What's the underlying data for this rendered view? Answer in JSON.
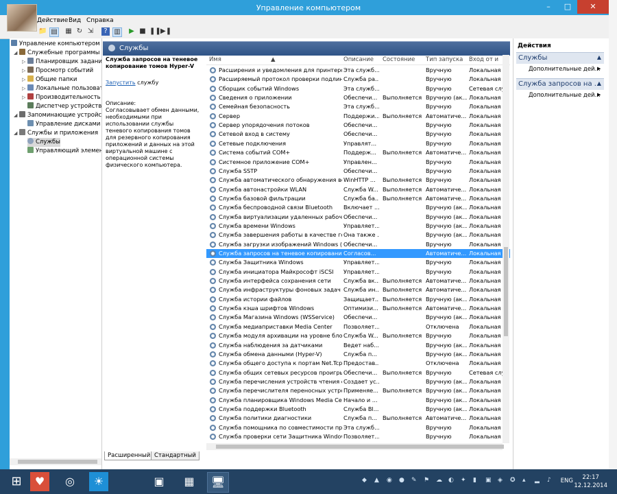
{
  "window": {
    "title": "Управление компьютером",
    "minimize": "–",
    "maximize": "□",
    "close": "✕"
  },
  "menu": [
    "Действие",
    "Вид",
    "Справка"
  ],
  "toolbar": {
    "icons": [
      "back-icon",
      "forward-icon",
      "folder-up-icon",
      "show-tree-icon",
      "properties-icon",
      "refresh-icon",
      "export-icon",
      "help-icon",
      "console-icon",
      "play-icon",
      "stop-icon",
      "pause-icon",
      "restart-icon"
    ]
  },
  "tree": {
    "items": [
      {
        "label": "Управление компьютером (л",
        "arrow": "",
        "icon_color": "#5b7fa8"
      },
      {
        "label": "Служебные программы",
        "arrow": "◢",
        "icon_color": "#8a6a3a"
      },
      {
        "label": "Планировщик заданий",
        "arrow": "▷",
        "icon_color": "#6c7f9a"
      },
      {
        "label": "Просмотр событий",
        "arrow": "▷",
        "icon_color": "#7c6a55"
      },
      {
        "label": "Общие папки",
        "arrow": "▷",
        "icon_color": "#d9b24d"
      },
      {
        "label": "Локальные пользовате",
        "arrow": "▷",
        "icon_color": "#6b8ab5"
      },
      {
        "label": "Производительность",
        "arrow": "▷",
        "icon_color": "#b04040"
      },
      {
        "label": "Диспетчер устройств",
        "arrow": "",
        "icon_color": "#5b7c5b"
      },
      {
        "label": "Запоминающие устройст",
        "arrow": "◢",
        "icon_color": "#6d6d6d"
      },
      {
        "label": "Управление дисками",
        "arrow": "",
        "icon_color": "#6d8fb0"
      },
      {
        "label": "Службы и приложения",
        "arrow": "◢",
        "icon_color": "#7a7a7a"
      },
      {
        "label": "Службы",
        "arrow": "",
        "icon_color": "#8fa3bd"
      },
      {
        "label": "Управляющий элемент",
        "arrow": "",
        "icon_color": "#6fa06f"
      }
    ]
  },
  "center": {
    "header": "Службы",
    "description": {
      "title": "Служба запросов на теневое копирование томов Hyper-V",
      "link": "Запустить",
      "link_suffix": " службу",
      "label": "Описание:",
      "body": "Согласовывает обмен данными, необходимыми при использовании службы теневого копирования томов для резервного копирования приложений и данных на этой виртуальной машине с операционной системы физического компьютера."
    },
    "columns": [
      "Имя",
      "Описание",
      "Состояние",
      "Тип запуска",
      "Вход от и"
    ],
    "rows": [
      [
        "Расширения и уведомления для принтеров",
        "Эта служб...",
        "",
        "Вручную",
        "Локальная с"
      ],
      [
        "Расширяемый протокол проверки подлинн...",
        "Служба ра...",
        "",
        "Вручную",
        "Локальная с"
      ],
      [
        "Сборщик событий Windows",
        "Эта служб...",
        "",
        "Вручную",
        "Сетевая слу"
      ],
      [
        "Сведения о приложении",
        "Обеспечи...",
        "Выполняется",
        "Вручную (ак...",
        "Локальная с"
      ],
      [
        "Семейная безопасность",
        "Эта служб...",
        "",
        "Вручную",
        "Локальная с"
      ],
      [
        "Сервер",
        "Поддержи...",
        "Выполняется",
        "Автоматиче...",
        "Локальная с"
      ],
      [
        "Сервер упорядочения потоков",
        "Обеспечи...",
        "",
        "Вручную",
        "Локальная с"
      ],
      [
        "Сетевой вход в систему",
        "Обеспечи...",
        "",
        "Вручную",
        "Локальная с"
      ],
      [
        "Сетевые подключения",
        "Управлят...",
        "",
        "Вручную",
        "Локальная с"
      ],
      [
        "Система событий COM+",
        "Поддерж...",
        "Выполняется",
        "Автоматиче...",
        "Локальная с"
      ],
      [
        "Системное приложение COM+",
        "Управлен...",
        "",
        "Вручную",
        "Локальная с"
      ],
      [
        "Служба SSTP",
        "Обеспечи...",
        "",
        "Вручную",
        "Локальная с"
      ],
      [
        "Служба автоматического обнаружения веб-...",
        "WinHTTP ...",
        "Выполняется",
        "Вручную",
        "Локальная с"
      ],
      [
        "Служба автонастройки WLAN",
        "Служба W...",
        "Выполняется",
        "Автоматиче...",
        "Локальная с"
      ],
      [
        "Служба базовой фильтрации",
        "Служба ба...",
        "Выполняется",
        "Автоматиче...",
        "Локальная с"
      ],
      [
        "Служба беспроводной связи Bluetooth",
        "Включает ...",
        "",
        "Вручную (ак...",
        "Локальная с"
      ],
      [
        "Служба виртуализации удаленных рабочих с...",
        "Обеспечи...",
        "",
        "Вручную (ак...",
        "Локальная с"
      ],
      [
        "Служба времени Windows",
        "Управляет...",
        "",
        "Вручную (ак...",
        "Локальная с"
      ],
      [
        "Служба завершения работы в качестве гост...",
        "Она также ...",
        "",
        "Вручную (ак...",
        "Локальная с"
      ],
      [
        "Служба загрузки изображений Windows (WIA)",
        "Обеспечи...",
        "",
        "Вручную",
        "Локальная с"
      ],
      [
        "Служба запросов на теневое копирование т...",
        "Согласов...",
        "",
        "Автоматиче...",
        "Локальная с"
      ],
      [
        "Служба Защитника Windows",
        "Управляет...",
        "",
        "Вручную",
        "Локальная с"
      ],
      [
        "Служба инициатора Майкрософт iSCSI",
        "Управляет...",
        "",
        "Вручную",
        "Локальная с"
      ],
      [
        "Служба интерфейса сохранения сети",
        "Служба вк...",
        "Выполняется",
        "Автоматиче...",
        "Локальная с"
      ],
      [
        "Служба инфраструктуры фоновых задач",
        "Служба ин...",
        "Выполняется",
        "Автоматиче...",
        "Локальная с"
      ],
      [
        "Служба истории файлов",
        "Защищает...",
        "Выполняется",
        "Вручную (ак...",
        "Локальная с"
      ],
      [
        "Служба кэша шрифтов Windows",
        "Оптимизи...",
        "Выполняется",
        "Автоматиче...",
        "Локальная с"
      ],
      [
        "Служба Магазина Windows (WSService)",
        "Обеспечи...",
        "",
        "Вручную (ак...",
        "Локальная с"
      ],
      [
        "Служба медиаприставки Media Center",
        "Позволяет...",
        "",
        "Отключена",
        "Локальная с"
      ],
      [
        "Служба модуля архивации на уровне блоков",
        "Служба W...",
        "Выполняется",
        "Вручную",
        "Локальная с"
      ],
      [
        "Служба наблюдения за датчиками",
        "Ведет наб...",
        "",
        "Вручную (ак...",
        "Локальная с"
      ],
      [
        "Служба обмена данными (Hyper-V)",
        "Служба п...",
        "",
        "Вручную (ак...",
        "Локальная с"
      ],
      [
        "Служба общего доступа к портам Net.Tcp",
        "Предостав...",
        "",
        "Отключена",
        "Локальная с"
      ],
      [
        "Служба общих сетевых ресурсов проигрыва...",
        "Обеспечи...",
        "Выполняется",
        "Вручную",
        "Сетевая слу"
      ],
      [
        "Служба перечисления устройств чтения сма...",
        "Создает ус...",
        "",
        "Вручную (ак...",
        "Локальная с"
      ],
      [
        "Служба перечислителя переносных устройств",
        "Применяе...",
        "Выполняется",
        "Вручную (ак...",
        "Локальная с"
      ],
      [
        "Служба планировщика Windows Media Center",
        "Начало и ...",
        "",
        "Вручную (ак...",
        "Локальная с"
      ],
      [
        "Служба поддержки Bluetooth",
        "Служба Bl...",
        "",
        "Вручную (ак...",
        "Локальная с"
      ],
      [
        "Служба политики диагностики",
        "Служба п...",
        "Выполняется",
        "Автоматиче...",
        "Локальная с"
      ],
      [
        "Служба помощника по совместимости прогр...",
        "Эта служб...",
        "",
        "Вручную",
        "Локальная с"
      ],
      [
        "Служба проверки сети Защитника Windows",
        "Позволяет...",
        "",
        "Вручную",
        "Локальная с"
      ]
    ],
    "selected_row_name": "Служба запросов на теневое копирование т...",
    "tabs": [
      "Расширенный",
      "Стандартный"
    ]
  },
  "actions": {
    "title": "Действия",
    "sections": [
      {
        "header": "Службы",
        "item": "Дополнительные дей..."
      },
      {
        "header": "Служба запросов на ...",
        "item": "Дополнительные дей..."
      }
    ]
  },
  "taskbar": {
    "apps": [
      "windows-start-icon",
      "health-app-icon",
      "media-app-icon",
      "weather-app-icon",
      "remote-desktop-icon",
      "windows-store-icon",
      "download-app-icon",
      "computer-management-icon"
    ],
    "language": "ENG",
    "time": "22:17",
    "date": "12.12.2014"
  }
}
